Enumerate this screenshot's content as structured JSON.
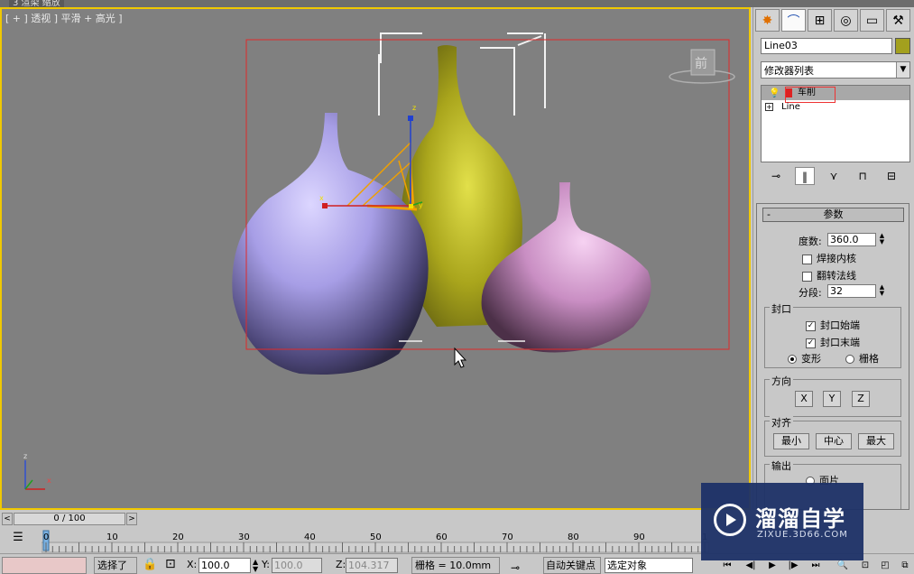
{
  "window": {
    "title": "3 渲染 缩放"
  },
  "viewport": {
    "label": "[ + ] 透视 ] 平滑 + 高光 ]",
    "viewcube_label": "前",
    "gizmo_labels": {
      "z": "z",
      "y": "y",
      "x": "x"
    },
    "axis_labels": {
      "z": "z",
      "x": "x"
    }
  },
  "command_panel": {
    "tabs": [
      {
        "icon": "create-icon",
        "glyph": "✸"
      },
      {
        "icon": "modify-icon",
        "glyph": "⌒"
      },
      {
        "icon": "hierarchy-icon",
        "glyph": "⊞"
      },
      {
        "icon": "motion-icon",
        "glyph": "◎"
      },
      {
        "icon": "display-icon",
        "glyph": "▭"
      },
      {
        "icon": "utilities-icon",
        "glyph": "⚒"
      }
    ],
    "object_name": "Line03",
    "object_color": "#a3a01e",
    "modifier_list": "修改器列表",
    "stack": [
      {
        "label": "车削",
        "selected": true
      },
      {
        "label": "Line",
        "selected": false
      }
    ]
  },
  "parameters": {
    "title": "参数",
    "collapse": "-",
    "degrees_label": "度数:",
    "degrees_value": "360.0",
    "weld_core_label": "焊接内核",
    "flip_normals_label": "翻转法线",
    "segments_label": "分段:",
    "segments_value": "32",
    "capping": {
      "label": "封口",
      "cap_start": "封口始端",
      "cap_end": "封口末端",
      "morph": "变形",
      "grid": "栅格"
    },
    "direction": {
      "label": "方向",
      "x": "X",
      "y": "Y",
      "z": "Z"
    },
    "align": {
      "label": "对齐",
      "min": "最小",
      "center": "中心",
      "max": "最大"
    },
    "output": {
      "label": "输出",
      "patch": "面片"
    }
  },
  "timeline": {
    "prev": "<",
    "next": ">",
    "position": "0 / 100",
    "ticks": [
      "0",
      "10",
      "20",
      "30",
      "40",
      "50",
      "60",
      "70",
      "80",
      "90",
      "1"
    ]
  },
  "status": {
    "selected_text": "选择了",
    "x_label": "X:",
    "x_value": "100.0",
    "y_label": "Y:",
    "y_value": "100.0",
    "z_label": "Z:",
    "z_value": "104.317",
    "grid": "栅格 = 10.0mm",
    "auto_key": "自动关键点",
    "selection_set": "选定对象"
  },
  "watermark": {
    "title": "溜溜自学",
    "url": "ZIXUE.3D66.COM"
  }
}
